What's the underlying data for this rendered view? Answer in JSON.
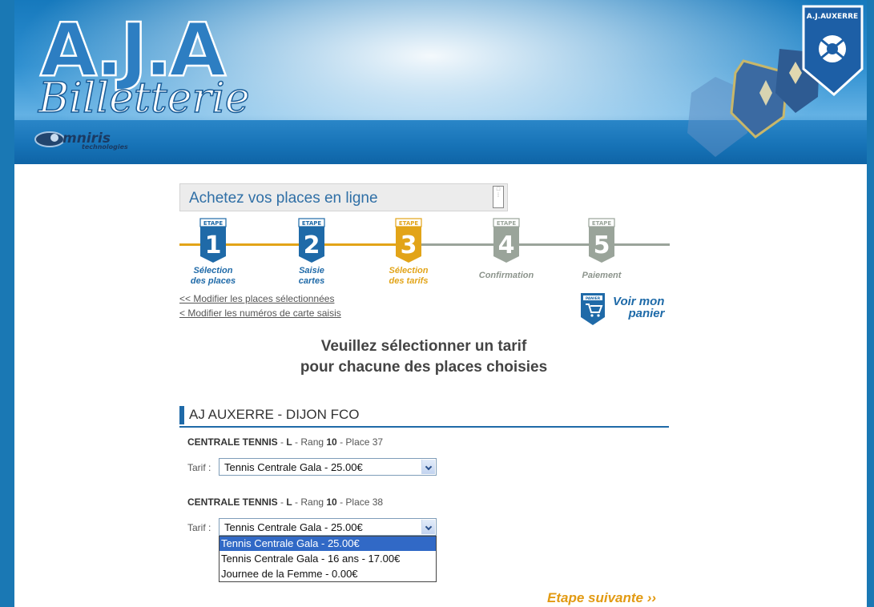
{
  "header": {
    "logo_letters": "A.J.A",
    "logo_word": "Billetterie",
    "sponsor_name": "mniris",
    "sponsor_sub": "technologies",
    "crest_text": "A.J.AUXERRE",
    "colors": {
      "primary": "#1a78b4",
      "accent": "#e29a12"
    }
  },
  "title": "Achetez vos places en ligne",
  "steps": [
    {
      "tag": "ETAPE",
      "number": "1",
      "label_line1": "Sélection",
      "label_line2": "des places",
      "state": "done",
      "color": "#1f6aa8"
    },
    {
      "tag": "ETAPE",
      "number": "2",
      "label_line1": "Saisie",
      "label_line2": "cartes",
      "state": "done",
      "color": "#1f6aa8"
    },
    {
      "tag": "ETAPE",
      "number": "3",
      "label_line1": "Sélection",
      "label_line2": "des tarifs",
      "state": "current",
      "color": "#e2a418"
    },
    {
      "tag": "ETAPE",
      "number": "4",
      "label_line1": "Confirmation",
      "label_line2": "",
      "state": "todo",
      "color": "#9aa49a"
    },
    {
      "tag": "ETAPE",
      "number": "5",
      "label_line1": "Paiement",
      "label_line2": "",
      "state": "todo",
      "color": "#9aa49a"
    }
  ],
  "links": {
    "modify_places": "<< Modifier les places sélectionnées",
    "modify_cards": "< Modifier les numéros de carte saisis"
  },
  "cart": {
    "tag": "PANIER",
    "line1": "Voir mon",
    "line2": "panier"
  },
  "instructions": {
    "line1": "Veuillez sélectionner un tarif",
    "line2": "pour chacune des places choisies"
  },
  "match": {
    "title": "AJ AUXERRE - DIJON FCO"
  },
  "places": [
    {
      "tribune": "CENTRALE TENNIS",
      "sep1": " - ",
      "bloc": "L",
      "rang_label": " - Rang ",
      "rang": "10",
      "place_label": " - Place ",
      "place": "37",
      "tarif_label": "Tarif :",
      "selected": "Tennis Centrale Gala - 25.00€"
    },
    {
      "tribune": "CENTRALE TENNIS",
      "sep1": " - ",
      "bloc": "L",
      "rang_label": " - Rang ",
      "rang": "10",
      "place_label": " - Place ",
      "place": "38",
      "tarif_label": "Tarif :",
      "selected": "Tennis Centrale Gala - 25.00€"
    }
  ],
  "dropdown_options": [
    "Tennis Centrale Gala - 25.00€",
    "Tennis Centrale Gala - 16 ans - 17.00€",
    "Journee de la Femme - 0.00€"
  ],
  "next_label": "Etape suivante ››"
}
